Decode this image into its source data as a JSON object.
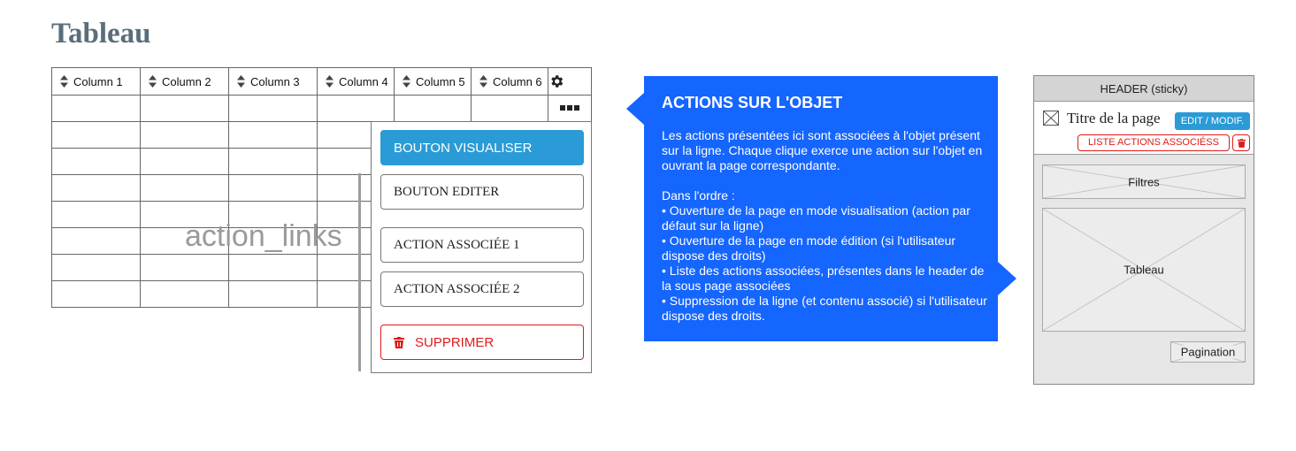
{
  "page": {
    "title": "Tableau"
  },
  "table": {
    "columns": [
      "Column 1",
      "Column 2",
      "Column 3",
      "Column 4",
      "Column 5",
      "Column 6"
    ],
    "settings_icon": "gear-icon",
    "row_actions_icon": "ellipsis-icon",
    "sort_icon": "sort-icon",
    "annotation": "action_links"
  },
  "dropdown": {
    "visualiser": "BOUTON VISUALISER",
    "editer": "BOUTON EDITER",
    "action1": "ACTION ASSOCIÉE 1",
    "action2": "ACTION ASSOCIÉE 2",
    "supprimer": "SUPPRIMER"
  },
  "callout": {
    "title": "ACTIONS SUR L'OBJET",
    "paragraph": "Les actions présentées ici sont associées à l'objet présent sur la ligne. Chaque clique exerce une action sur l'objet en ouvrant la page correspondante.",
    "intro": "Dans l'ordre :",
    "items": [
      "• Ouverture de la page en mode visualisation (action par défaut sur la ligne)",
      "• Ouverture de la page en mode édition (si l'utilisateur dispose des droits)",
      "• Liste des actions associées, présentes dans le header de la sous page associées",
      "• Suppression de la ligne (et contenu associé) si l'utilisateur dispose des droits."
    ],
    "color": "#1565ff"
  },
  "mockup": {
    "header": "HEADER (sticky)",
    "page_title": "Titre de la page",
    "edit_button": "EDIT / MODIF.",
    "actions_button": "LISTE ACTIONS ASSOCIÉSS",
    "filters": "Filtres",
    "table": "Tableau",
    "pagination": "Pagination"
  },
  "colors": {
    "primary": "#2a9bd6",
    "danger": "#e11a1a",
    "title": "#5a6e7a"
  }
}
